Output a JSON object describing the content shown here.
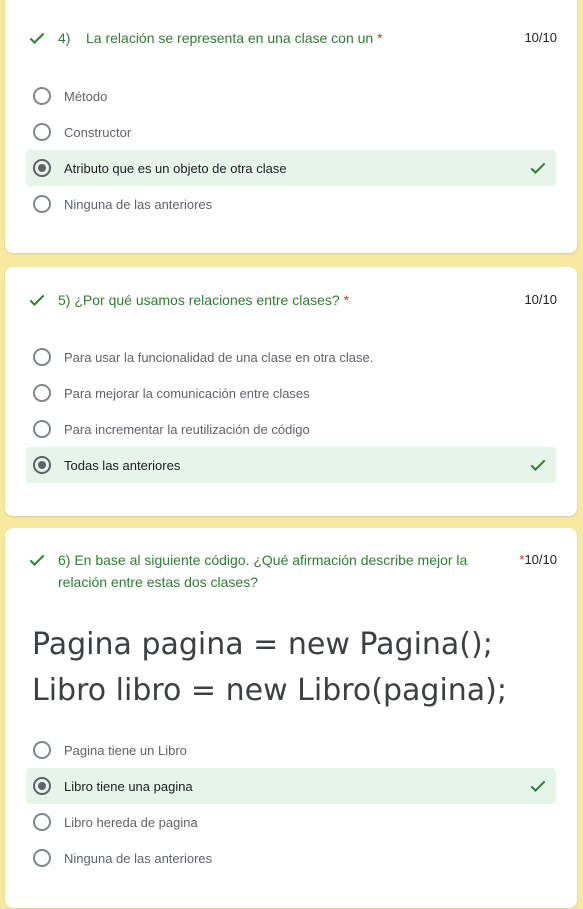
{
  "questions": [
    {
      "title": "4)    La relación se representa en una clase con un",
      "required_mark": "*",
      "score": "10/10",
      "options": [
        {
          "label": "Método",
          "selected": false
        },
        {
          "label": "Constructor",
          "selected": false
        },
        {
          "label": "Atributo que es un objeto de otra clase",
          "selected": true
        },
        {
          "label": "Ninguna de las anteriores",
          "selected": false
        }
      ]
    },
    {
      "title": "5) ¿Por qué usamos relaciones entre clases?",
      "required_mark": "*",
      "score": "10/10",
      "options": [
        {
          "label": "Para usar la funcionalidad de una clase en otra clase.",
          "selected": false
        },
        {
          "label": "Para mejorar la comunicación entre clases",
          "selected": false
        },
        {
          "label": "Para incrementar la reutilización de código",
          "selected": false
        },
        {
          "label": "Todas las anteriores",
          "selected": true
        }
      ]
    },
    {
      "title": "6) En base al siguiente código. ¿Qué afirmación describe mejor la relación entre estas dos clases?",
      "required_mark": "*",
      "score": "10/10",
      "code_lines": [
        "Pagina pagina = new Pagina();",
        "Libro libro = new Libro(pagina);"
      ],
      "options": [
        {
          "label": "Pagina tiene un Libro",
          "selected": false
        },
        {
          "label": "Libro tiene una pagina",
          "selected": true
        },
        {
          "label": "Libro hereda de pagina",
          "selected": false
        },
        {
          "label": "Ninguna de las anteriores",
          "selected": false
        }
      ]
    }
  ],
  "colors": {
    "page_background": "#f8e9a1",
    "correct_green": "#2e7d32",
    "selected_background": "#e6f4ea",
    "required_red": "#d93025"
  },
  "icons": {
    "correct": "check-icon"
  }
}
